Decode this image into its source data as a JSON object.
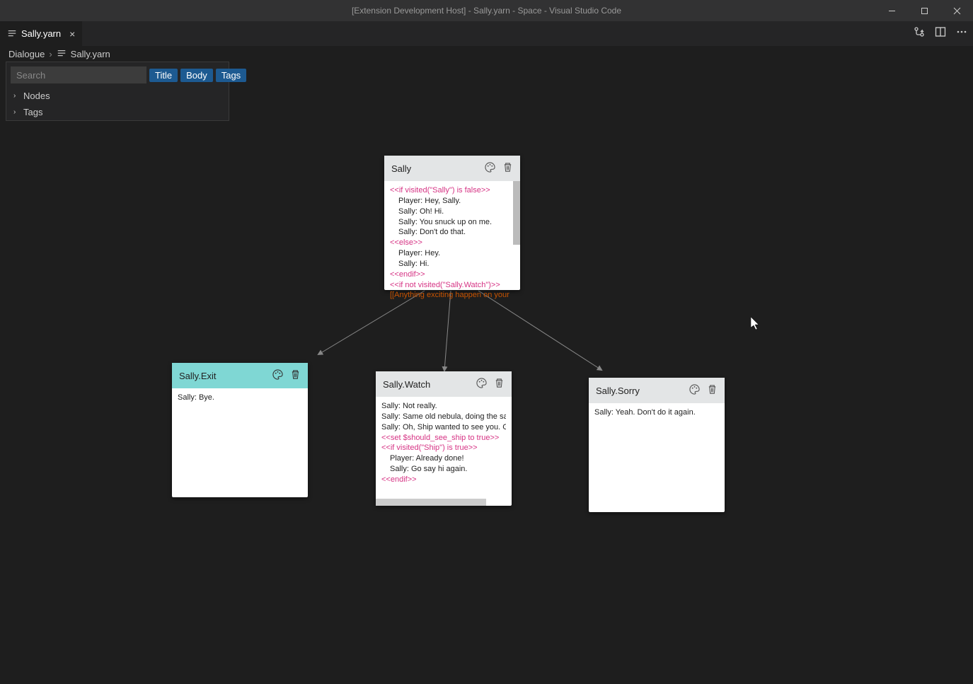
{
  "titlebar": {
    "title": "[Extension Development Host] - Sally.yarn - Space - Visual Studio Code"
  },
  "tab": {
    "label": "Sally.yarn"
  },
  "breadcrumb": {
    "folder": "Dialogue",
    "file": "Sally.yarn"
  },
  "sidepanel": {
    "search_placeholder": "Search",
    "filter_title": "Title",
    "filter_body": "Body",
    "filter_tags": "Tags",
    "tree_nodes": "Nodes",
    "tree_tags": "Tags"
  },
  "nodes": {
    "sally": {
      "title": "Sally",
      "lines": [
        {
          "text": "<<if visited(\"Sally\") is false>>",
          "cls": "magenta"
        },
        {
          "text": "Player: Hey, Sally.",
          "cls": "indent"
        },
        {
          "text": "Sally: Oh! Hi.",
          "cls": "indent"
        },
        {
          "text": "Sally: You snuck up on me.",
          "cls": "indent"
        },
        {
          "text": "Sally: Don't do that.",
          "cls": "indent"
        },
        {
          "text": "<<else>>",
          "cls": "magenta"
        },
        {
          "text": "Player: Hey.",
          "cls": "indent"
        },
        {
          "text": "Sally: Hi.",
          "cls": "indent"
        },
        {
          "text": "<<endif>>",
          "cls": "magenta"
        },
        {
          "text": "<<if not visited(\"Sally.Watch\")>>",
          "cls": "magenta"
        },
        {
          "text": "[[Anything exciting happen on your",
          "cls": "orange"
        }
      ]
    },
    "exit": {
      "title": "Sally.Exit",
      "lines": [
        {
          "text": "Sally: Bye.",
          "cls": ""
        }
      ]
    },
    "watch": {
      "title": "Sally.Watch",
      "lines": [
        {
          "text": "Sally: Not really.",
          "cls": ""
        },
        {
          "text": "Sally: Same old nebula, doing the same old t",
          "cls": ""
        },
        {
          "text": "Sally: Oh, Ship wanted to see you. Go say hi",
          "cls": ""
        },
        {
          "text": "<<set $should_see_ship to true>>",
          "cls": "magenta"
        },
        {
          "text": "<<if visited(\"Ship\") is true>>",
          "cls": "magenta"
        },
        {
          "text": "Player: Already done!",
          "cls": "indent"
        },
        {
          "text": "Sally: Go say hi again.",
          "cls": "indent"
        },
        {
          "text": "<<endif>>",
          "cls": "magenta"
        }
      ]
    },
    "sorry": {
      "title": "Sally.Sorry",
      "lines": [
        {
          "text": "Sally: Yeah. Don't do it again.",
          "cls": ""
        }
      ]
    }
  }
}
